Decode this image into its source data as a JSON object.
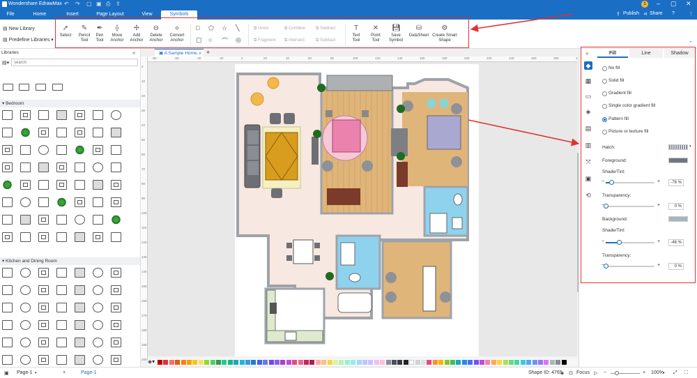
{
  "window": {
    "app_title": "Wondershare EdrawMax"
  },
  "menu": {
    "tabs": [
      "File",
      "Home",
      "Insert",
      "Page Layout",
      "View",
      "Symbols"
    ],
    "active": "Symbols",
    "publish": "Publish",
    "share": "Share"
  },
  "ribbon": {
    "new_library": "New Library",
    "predefine_libraries": "Predefine Libraries",
    "tools": [
      {
        "label": "Select"
      },
      {
        "label": "Pencil Tool"
      },
      {
        "label": "Pen Tool"
      },
      {
        "label": "Move Anchor"
      },
      {
        "label": "Add Anchor"
      },
      {
        "label": "Delete Anchor"
      },
      {
        "label": "Convert Anchor"
      }
    ],
    "boolean": {
      "union": "Union",
      "combine": "Combine",
      "subtract": "Subtract",
      "fragment": "Fragment",
      "intersect": "Intersect",
      "subtract2": "Subtract"
    },
    "tools2": [
      {
        "label": "Text Tool"
      },
      {
        "label": "Point Tool"
      },
      {
        "label": "Save Symbol"
      },
      {
        "label": "DataSheet"
      },
      {
        "label": "Create Smart Shape"
      }
    ]
  },
  "library": {
    "title": "Libraries",
    "search_placeholder": "search",
    "sections": [
      {
        "name": "Bedroom"
      },
      {
        "name": "Kitchen and Dining Room"
      }
    ]
  },
  "document": {
    "tab_label": "A Sample Home...",
    "ruler_top": [
      "-80",
      "-60",
      "-40",
      "-20",
      "0",
      "20",
      "40",
      "60",
      "80",
      "100",
      "120",
      "140",
      "160",
      "180",
      "200",
      "220",
      "240",
      "260",
      "280",
      "300"
    ],
    "ruler_left": [
      "0",
      "10",
      "20",
      "30",
      "40",
      "50",
      "60",
      "70",
      "80",
      "90",
      "100",
      "110",
      "120",
      "130",
      "140",
      "150",
      "160",
      "170",
      "180",
      "190",
      "200"
    ]
  },
  "format_panel": {
    "tabs": [
      "Fill",
      "Line",
      "Shadow"
    ],
    "active_tab": "Fill",
    "fill_options": [
      "No fill",
      "Solid fill",
      "Gradient fill",
      "Single color gradient fill",
      "Pattern fill",
      "Picture or texture fill"
    ],
    "selected_fill": "Pattern fill",
    "hatch_label": "Hatch:",
    "foreground_label": "Foreground:",
    "foreground_color": "#6e7780",
    "shade1_label": "Shade/Tint:",
    "shade1_value": "-76 %",
    "shade1_level": 0.12,
    "transparency1_label": "Transparency:",
    "transparency1_value": "0 %",
    "transparency1_level": 0.0,
    "background_label": "Background:",
    "background_color": "#a8b4c2",
    "shade2_label": "Shade/Tint:",
    "shade2_value": "-46 %",
    "shade2_level": 0.27,
    "transparency2_label": "Transparency:",
    "transparency2_value": "0 %",
    "transparency2_level": 0.0
  },
  "status": {
    "page_selector": "Page-1",
    "page_tab": "Page-1",
    "shape_id": "Shape ID: 4765",
    "focus": "Focus",
    "zoom": "100%"
  },
  "palette_colors": [
    "#c00000",
    "#e03131",
    "#ff6b6b",
    "#e8590c",
    "#fd7e14",
    "#f59f00",
    "#fcc419",
    "#ffe066",
    "#94d82d",
    "#51cf66",
    "#2f9e44",
    "#20c997",
    "#12b886",
    "#15aabf",
    "#22b8cf",
    "#339af0",
    "#1c7ed6",
    "#4263eb",
    "#5c7cfa",
    "#7048e8",
    "#845ef7",
    "#ae3ec9",
    "#be4bdb",
    "#e64980",
    "#f06595",
    "#c2255c",
    "#a61e4d",
    "#ffa8a8",
    "#ffc078",
    "#ffd43b",
    "#d8f5a2",
    "#b2f2bb",
    "#96f2d7",
    "#99e9f2",
    "#a5d8ff",
    "#bac8ff",
    "#d0bfff",
    "#eebefa",
    "#fcc2d7",
    "#868e96",
    "#495057",
    "#343a40",
    "#212529",
    "#ffffff",
    "#ced4da",
    "#dee2e6",
    "#e64980",
    "#ff922b",
    "#fab005",
    "#82c91e",
    "#40c057",
    "#15aabf",
    "#228be6",
    "#4c6ef5",
    "#7950f2",
    "#be4bdb",
    "#f783ac",
    "#ffa94d",
    "#ffd43b",
    "#a9e34b",
    "#69db7c",
    "#38d9a9",
    "#3bc9db",
    "#4dabf7",
    "#748ffc",
    "#9775fa",
    "#da77f2",
    "#adb5bd",
    "#868e96",
    "#000000"
  ]
}
